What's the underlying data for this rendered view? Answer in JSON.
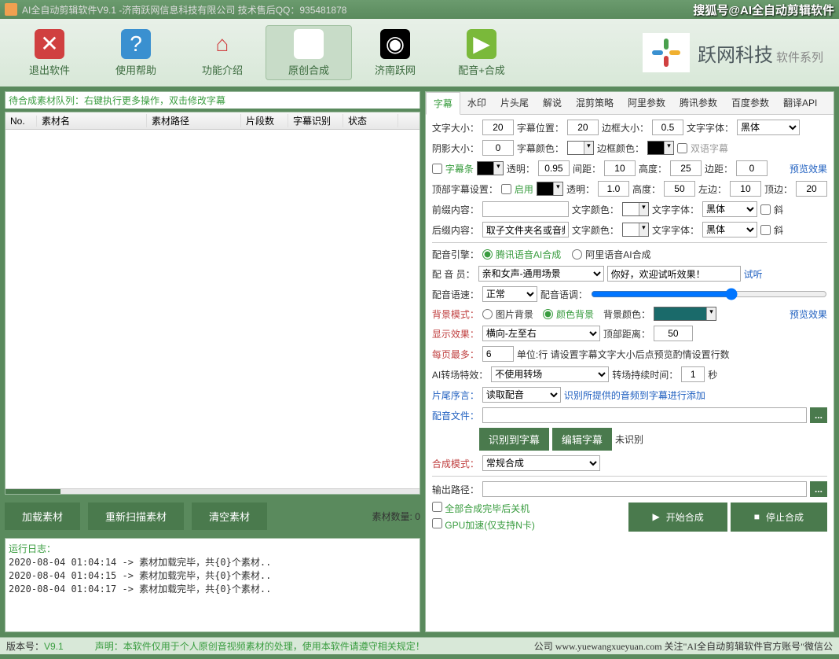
{
  "title": "AI全自动剪辑软件V9.1 -济南跃网信息科技有限公司  技术售后QQ：935481878",
  "brand": "搜狐号@AI全自动剪辑软件",
  "toolbar": [
    {
      "label": "配音+合成",
      "glyph": "▶",
      "bg": "#7ab93a",
      "active": false
    },
    {
      "label": "济南跃网",
      "glyph": "◉",
      "bg": "#000",
      "active": false
    },
    {
      "label": "原创合成",
      "glyph": "🖼",
      "bg": "#fff",
      "active": true
    },
    {
      "label": "功能介绍",
      "glyph": "⌂",
      "bg": "transparent",
      "color": "#d04040",
      "active": false
    },
    {
      "label": "使用帮助",
      "glyph": "?",
      "bg": "#3a90d0",
      "active": false
    },
    {
      "label": "退出软件",
      "glyph": "✕",
      "bg": "#d04040",
      "active": false
    }
  ],
  "logo": {
    "main": "跃网科技",
    "sub": "软件系列"
  },
  "left": {
    "hint": "待合成素材队列：右键执行更多操作，双击修改字幕",
    "cols": [
      "No.",
      "素材名",
      "素材路径",
      "片段数",
      "字幕识别",
      "状态"
    ],
    "btns": {
      "load": "加载素材",
      "rescan": "重新扫描素材",
      "clear": "清空素材"
    },
    "count_label": "素材数量: ",
    "count": "0",
    "log_title": "运行日志：",
    "logs": [
      "2020-08-04 01:04:14 -> 素材加载完毕，共{0}个素材..",
      "2020-08-04 01:04:15 -> 素材加载完毕，共{0}个素材..",
      "2020-08-04 01:04:17 -> 素材加载完毕，共{0}个素材.."
    ]
  },
  "tabs": [
    "字幕",
    "水印",
    "片头尾",
    "解说",
    "混剪策略",
    "阿里参数",
    "腾讯参数",
    "百度参数",
    "翻译API"
  ],
  "p": {
    "font_size_l": "文字大小：",
    "font_size": "20",
    "pos_l": "字幕位置：",
    "pos": "20",
    "border_l": "边框大小：",
    "border": "0.5",
    "font_l": "文字字体：",
    "font": "黑体",
    "shadow_l": "阴影大小：",
    "shadow": "0",
    "sub_color_l": "字幕颜色：",
    "sub_color": "#ffffff",
    "border_color_l": "边框颜色：",
    "border_color": "#000000",
    "bilingual": "双语字幕",
    "strip": "字幕条",
    "strip_color": "#000000",
    "opacity_l": "透明：",
    "opacity": "0.95",
    "gap_l": "间距：",
    "gap": "10",
    "height_l": "高度：",
    "height": "25",
    "margin_l": "边距：",
    "margin": "0",
    "preview": "预览效果",
    "top_l": "顶部字幕设置：",
    "enable": "启用",
    "top_color": "#000000",
    "top_opacity": "1.0",
    "top_height": "50",
    "top_left_l": "左边：",
    "top_left": "10",
    "top_top_l": "顶边：",
    "top_top": "20",
    "prefix_l": "前缀内容：",
    "prefix": "",
    "text_color_l": "文字颜色：",
    "text_color": "#ffffff",
    "text_font_l": "文字字体：",
    "text_font": "黑体",
    "italic": "斜",
    "suffix_l": "后缀内容：",
    "suffix": "取子文件夹名或音频",
    "engine_l": "配音引擎：",
    "engine1": "腾讯语音AI合成",
    "engine2": "阿里语音AI合成",
    "voice_l": "配 音 员：",
    "voice": "亲和女声-通用场景",
    "sample": "你好，欢迎试听效果！",
    "try": "试听",
    "speed_l": "配音语速：",
    "speed": "正常",
    "tone_l": "配音语调：",
    "bgmode_l": "背景模式：",
    "bgmode1": "图片背景",
    "bgmode2": "颜色背景",
    "bgcolor_l": "背景颜色：",
    "bgcolor": "#1a6a6a",
    "display_l": "显示效果：",
    "display": "横向-左至右",
    "topdist_l": "顶部距离：",
    "topdist": "50",
    "perpage_l": "每页最多：",
    "perpage": "6",
    "perpage_hint": "单位:行 请设置字幕文字大小后点预览酌情设置行数",
    "trans_l": "AI转场特效：",
    "trans": "不使用转场",
    "trans_dur_l": "转场持续时间：",
    "trans_dur": "1",
    "sec": "秒",
    "tail_l": "片尾序言：",
    "tail": "读取配音",
    "tail_hint": "识别所提供的音频到字幕进行添加",
    "audio_l": "配音文件：",
    "audio": "",
    "rec_btn": "识别到字幕",
    "edit_btn": "编辑字幕",
    "unrec": "未识别",
    "mode_l": "合成模式：",
    "mode": "常规合成",
    "out_l": "输出路径：",
    "out": "",
    "shutdown": "全部合成完毕后关机",
    "gpu": "GPU加速(仅支持N卡)",
    "start": "开始合成",
    "stop": "停止合成"
  },
  "footer": {
    "ver_l": "版本号：",
    "ver": "V9.1",
    "decl": "声明：本软件仅用于个人原创音视频素材的处理，使用本软件请遵守相关规定！",
    "site": "公司 www.yuewangxueyuan.com 关注\"AI全自动剪辑软件官方账号\"微信公"
  }
}
